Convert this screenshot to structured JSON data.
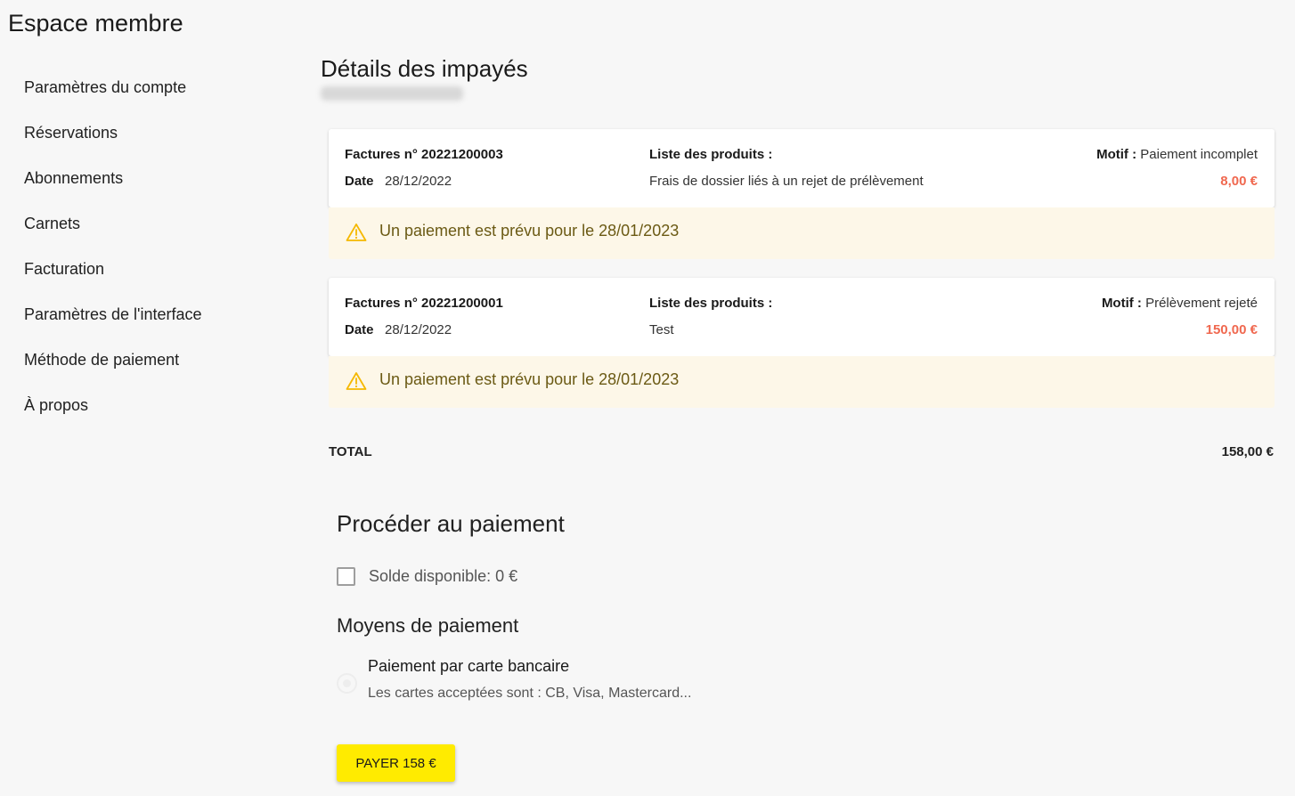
{
  "app": {
    "title": "Espace membre"
  },
  "sidebar": {
    "items": [
      {
        "label": "Paramètres du compte"
      },
      {
        "label": "Réservations"
      },
      {
        "label": "Abonnements"
      },
      {
        "label": "Carnets"
      },
      {
        "label": "Facturation"
      },
      {
        "label": "Paramètres de l'interface"
      },
      {
        "label": "Méthode de paiement"
      },
      {
        "label": "À propos"
      }
    ]
  },
  "main": {
    "title": "Détails des impayés",
    "invoices": [
      {
        "number_label": "Factures n° 20221200003",
        "date_label": "Date",
        "date": "28/12/2022",
        "products_label": "Liste des produits :",
        "products": "Frais de dossier liés à un rejet de prélèvement",
        "reason_label": "Motif :",
        "reason": "Paiement incomplet",
        "amount": "8,00 €",
        "notice": "Un paiement est prévu pour le 28/01/2023"
      },
      {
        "number_label": "Factures n° 20221200001",
        "date_label": "Date",
        "date": "28/12/2022",
        "products_label": "Liste des produits :",
        "products": "Test",
        "reason_label": "Motif :",
        "reason": "Prélèvement rejeté",
        "amount": "150,00 €",
        "notice": "Un paiement est prévu pour le 28/01/2023"
      }
    ],
    "total_label": "TOTAL",
    "total_value": "158,00 €"
  },
  "payment": {
    "title": "Procéder au paiement",
    "balance_label": "Solde disponible: 0 €",
    "balance_checked": false,
    "methods_title": "Moyens de paiement",
    "method": {
      "name": "Paiement par carte bancaire",
      "description": "Les cartes acceptées sont : CB, Visa, Mastercard..."
    },
    "button_label": "PAYER 158 €"
  },
  "colors": {
    "accent_button": "#ffeb00",
    "amount_red": "#f0684f",
    "notice_bg": "#fdf7e8",
    "warning_icon": "#f5b800"
  },
  "icons": {
    "notice": "warning-icon"
  }
}
